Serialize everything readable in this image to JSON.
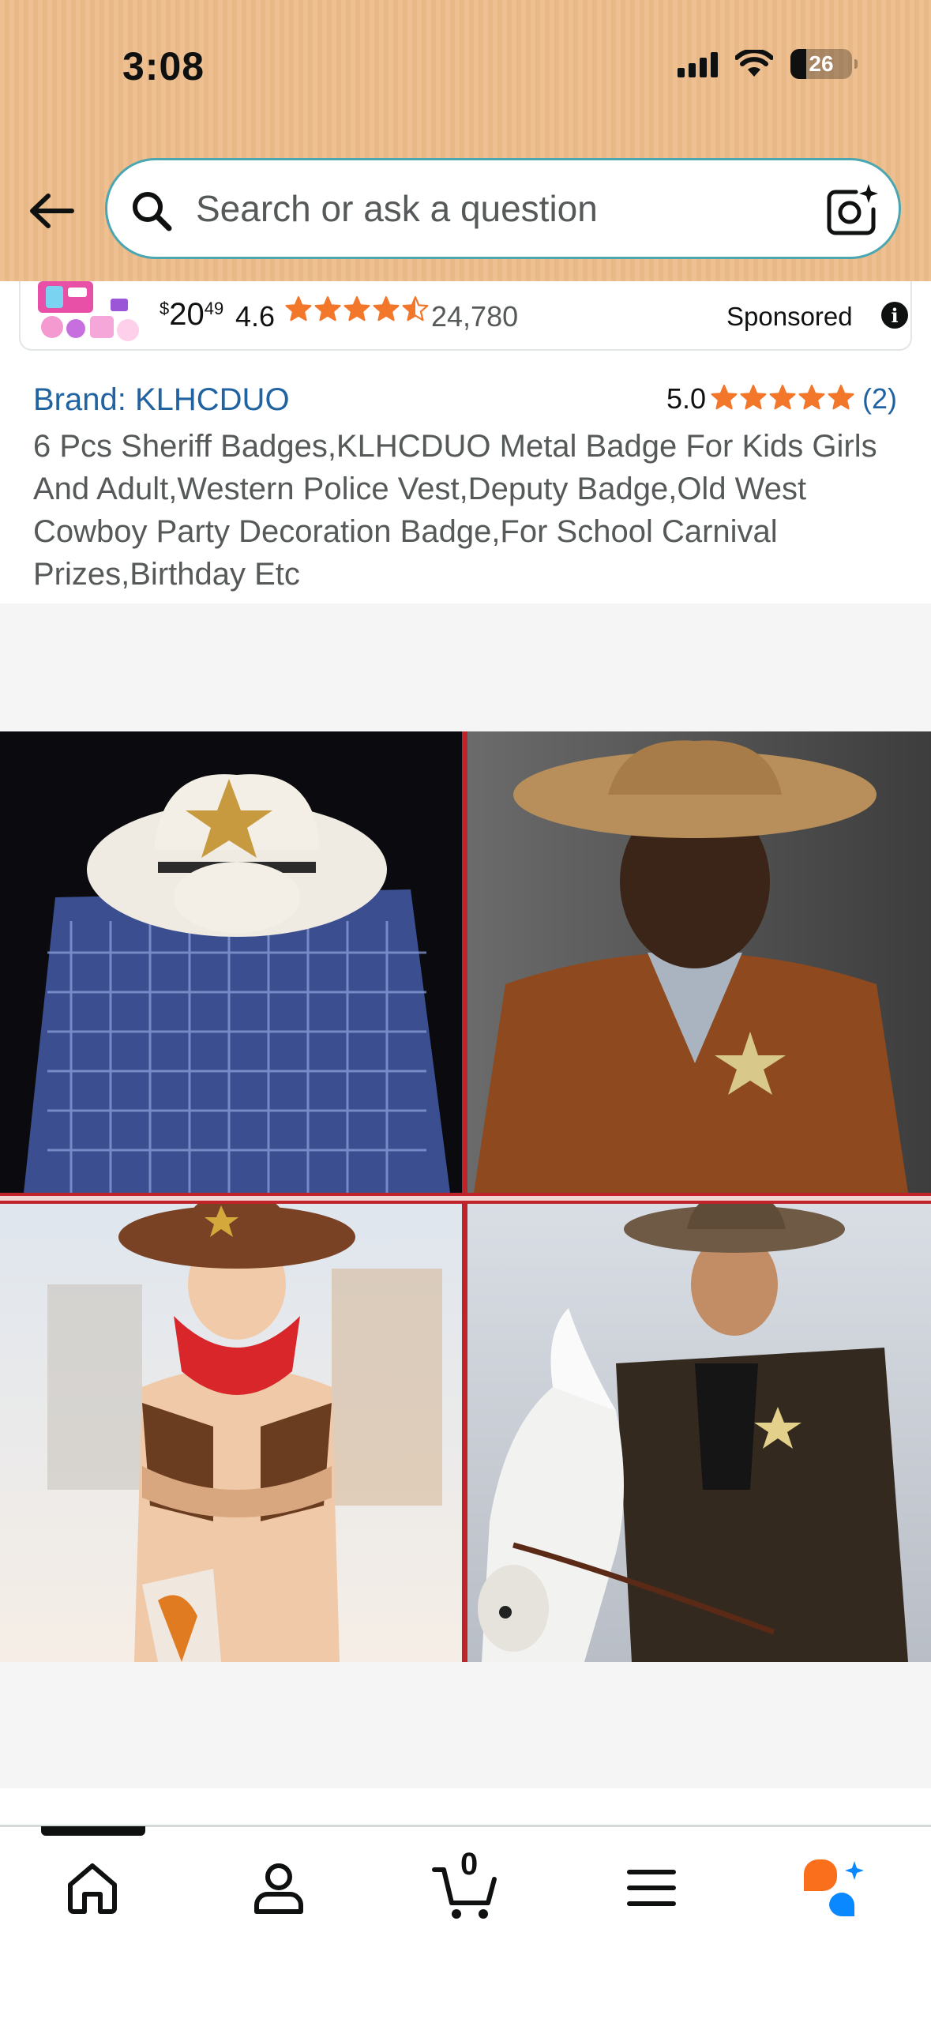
{
  "status_bar": {
    "time": "3:08",
    "battery": "26"
  },
  "search": {
    "placeholder": "Search or ask a question"
  },
  "sponsored": {
    "price_whole": "20",
    "price_fraction": "49",
    "currency": "$",
    "rating": "4.6",
    "rating_stars": 4.5,
    "review_count": "24,780",
    "label": "Sponsored"
  },
  "product": {
    "brand": "Brand: KLHCDUO",
    "rating": "5.0",
    "rating_stars": 5,
    "review_count": "(2)",
    "title": "6 Pcs Sheriff Badges,KLHCDUO Metal Badge For Kids Girls And Adult,Western Police Vest,Deputy Badge,Old West Cowboy Party Decoration Badge,For School Carnival Prizes,Birthday Etc"
  },
  "bottom_nav": {
    "items": [
      "home-icon",
      "account-icon",
      "cart-icon",
      "menu-icon",
      "rufus-assistant-icon"
    ],
    "cart_count": "0"
  },
  "colors": {
    "header_bg": "#edbc8a",
    "link": "#2162a1",
    "star": "#f3772a",
    "assistant_orange": "#f96f1b",
    "assistant_blue": "#0a88ff"
  }
}
